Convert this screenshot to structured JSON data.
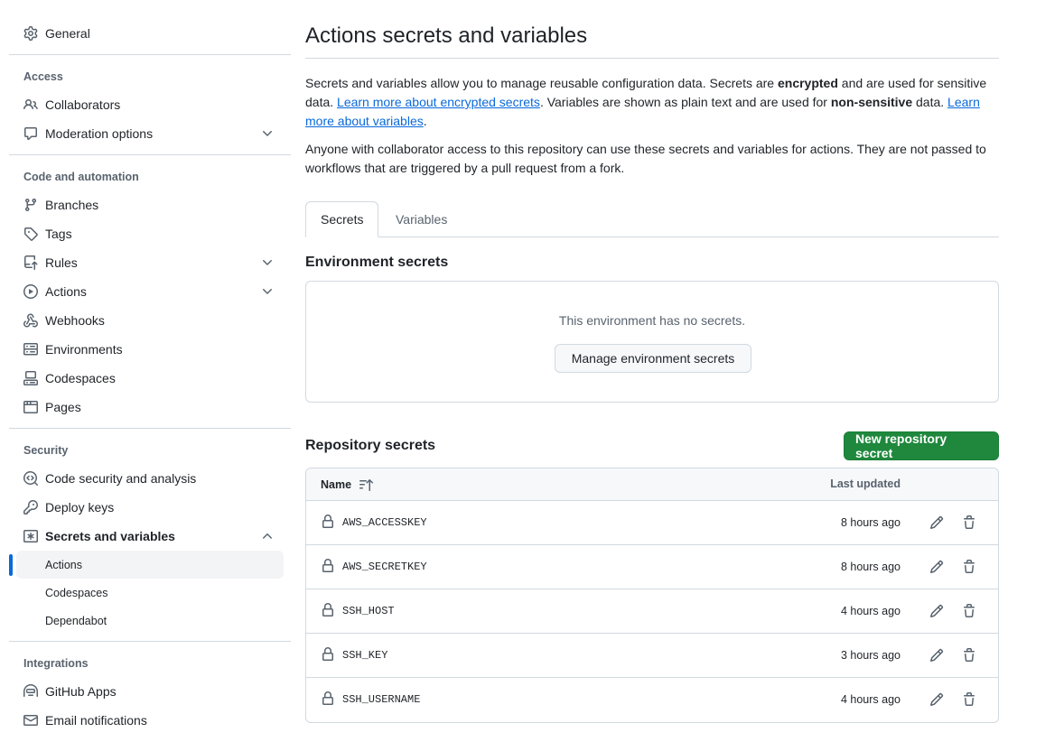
{
  "sidebar": {
    "general": "General",
    "access_heading": "Access",
    "collaborators": "Collaborators",
    "moderation": "Moderation options",
    "code_heading": "Code and automation",
    "branches": "Branches",
    "tags": "Tags",
    "rules": "Rules",
    "actions": "Actions",
    "webhooks": "Webhooks",
    "environments": "Environments",
    "codespaces": "Codespaces",
    "pages": "Pages",
    "security_heading": "Security",
    "code_security": "Code security and analysis",
    "deploy_keys": "Deploy keys",
    "secrets_vars": "Secrets and variables",
    "sub_actions": "Actions",
    "sub_codespaces": "Codespaces",
    "sub_dependabot": "Dependabot",
    "integrations_heading": "Integrations",
    "github_apps": "GitHub Apps",
    "email_notifications": "Email notifications"
  },
  "main": {
    "title": "Actions secrets and variables",
    "intro": {
      "t1": "Secrets and variables allow you to manage reusable configuration data. Secrets are ",
      "b1": "encrypted",
      "t2": " and are used for sensitive data. ",
      "link1": "Learn more about encrypted secrets",
      "t3": ". Variables are shown as plain text and are used for ",
      "b2": "non-sensitive",
      "t4": " data. ",
      "link2": "Learn more about variables",
      "t5": "."
    },
    "access_note": "Anyone with collaborator access to this repository can use these secrets and variables for actions. They are not passed to workflows that are triggered by a pull request from a fork.",
    "tabs": [
      "Secrets",
      "Variables"
    ],
    "env_heading": "Environment secrets",
    "env_empty": "This environment has no secrets.",
    "env_button": "Manage environment secrets",
    "repo_heading": "Repository secrets",
    "new_secret_button": "New repository secret",
    "table": {
      "col_name": "Name",
      "col_updated": "Last updated",
      "rows": [
        {
          "name": "AWS_ACCESSKEY",
          "updated": "8 hours ago"
        },
        {
          "name": "AWS_SECRETKEY",
          "updated": "8 hours ago"
        },
        {
          "name": "SSH_HOST",
          "updated": "4 hours ago"
        },
        {
          "name": "SSH_KEY",
          "updated": "3 hours ago"
        },
        {
          "name": "SSH_USERNAME",
          "updated": "4 hours ago"
        }
      ]
    }
  },
  "colors": {
    "accent": "#0969da",
    "primary_button": "#1f883d",
    "muted_text": "#59636e",
    "border": "#d1d9e0"
  }
}
